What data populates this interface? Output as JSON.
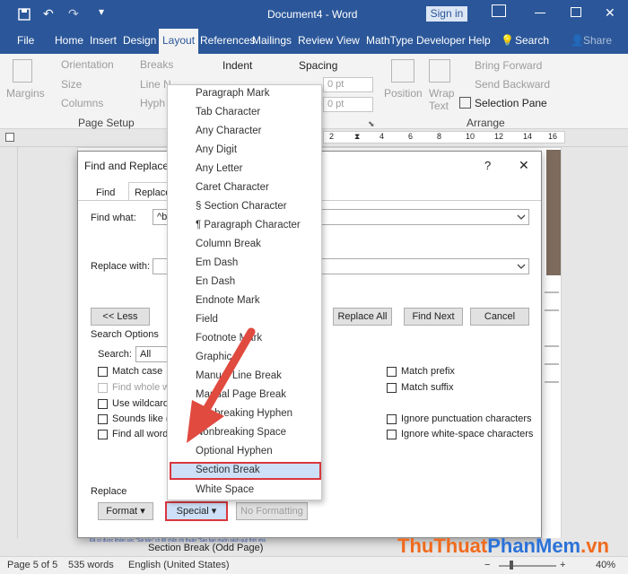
{
  "titlebar": {
    "title": "Document4 - Word",
    "sign_in": "Sign in"
  },
  "tabs": [
    "File",
    "Home",
    "Insert",
    "Design",
    "Layout",
    "References",
    "Mailings",
    "Review",
    "View",
    "MathType",
    "Developer",
    "Help"
  ],
  "tell_me": "Search",
  "share": "Share",
  "ribbon": {
    "margins": "Margins",
    "orientation": "Orientation",
    "size": "Size",
    "columns": "Columns",
    "breaks": "Breaks",
    "line_numbers": "Line N",
    "hyphenation": "Hyph",
    "page_setup": "Page Setup",
    "indent": "Indent",
    "spacing": "Spacing",
    "spacing_before": "0 pt",
    "spacing_after": "0 pt",
    "position": "Position",
    "wrap_text": "Wrap",
    "text": "Text",
    "bring_forward": "Bring Forward",
    "send_backward": "Send Backward",
    "selection_pane": "Selection Pane",
    "arrange": "Arrange"
  },
  "ruler": [
    "2",
    "4",
    "6",
    "8",
    "10",
    "12",
    "14",
    "16"
  ],
  "dialog": {
    "title": "Find and Replace",
    "help": "?",
    "close": "✕",
    "tab_find": "Find",
    "tab_replace": "Replace",
    "find_label": "Find what:",
    "find_value": "^b",
    "replace_label": "Replace with:",
    "replace_value": "",
    "less_btn": "<< Less",
    "replace_all_btn": "Replace All",
    "find_next_btn": "Find Next",
    "cancel_btn": "Cancel",
    "search_options": "Search Options",
    "search_label": "Search:",
    "search_value": "All",
    "opts_left": [
      "Match case",
      "Find whole words only",
      "Use wildcards",
      "Sounds like (English)",
      "Find all word forms (English)"
    ],
    "opts_right": [
      "Match prefix",
      "Match suffix",
      "Ignore punctuation characters",
      "Ignore white-space characters"
    ],
    "replace_section": "Replace",
    "format_btn": "Format",
    "special_btn": "Special",
    "no_formatting_btn": "No Formatting"
  },
  "special_menu": [
    "Paragraph Mark",
    "Tab Character",
    "Any Character",
    "Any Digit",
    "Any Letter",
    "Caret Character",
    "§ Section Character",
    "¶ Paragraph Character",
    "Column Break",
    "Em Dash",
    "En Dash",
    "Endnote Mark",
    "Field",
    "Footnote Mark",
    "Graphic",
    "Manual Line Break",
    "Manual Page Break",
    "Nonbreaking Hyphen",
    "Nonbreaking Space",
    "Optional Hyphen",
    "Section Break",
    "White Space"
  ],
  "doc": {
    "section_break": "Section Break (Odd Page)",
    "snippet": "Đã có được khám sức \"Sài bản\" có để chăn chị thuần \"Sao bạn muốn sách quý thời nhà"
  },
  "status": {
    "page": "Page 5 of 5",
    "words": "535 words",
    "language": "English (United States)",
    "zoom": "40%"
  },
  "watermark": {
    "part1": "ThuThuat",
    "part2": "PhanMem",
    "part3": ".vn"
  },
  "colors": {
    "word_blue": "#2b579a",
    "highlight_red": "#d9363e",
    "arrow_red": "#e04a3f",
    "watermark_orange": "#f06a1d",
    "watermark_blue": "#2b72d8"
  }
}
